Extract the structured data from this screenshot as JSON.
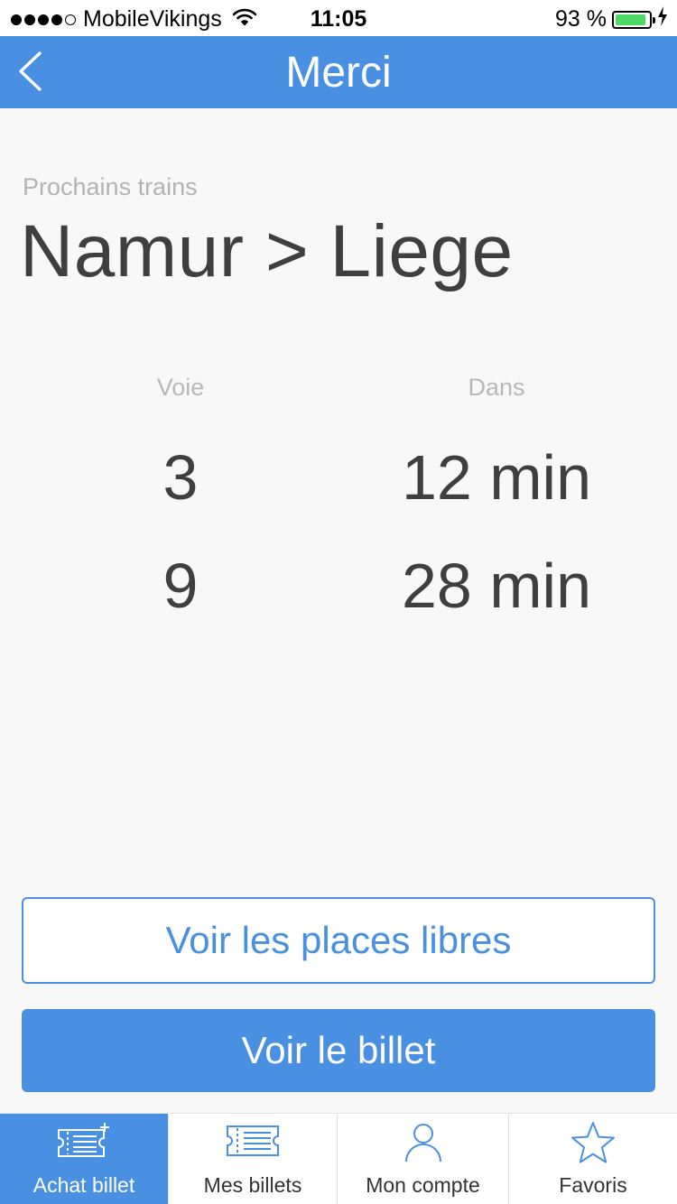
{
  "status_bar": {
    "carrier": "MobileVikings",
    "time": "11:05",
    "battery": "93 %",
    "battery_level": 0.93
  },
  "nav": {
    "title": "Merci",
    "back_icon": "chevron-left-icon"
  },
  "content": {
    "subtitle": "Prochains trains",
    "route": "Namur > Liege",
    "columns": {
      "platform": "Voie",
      "in": "Dans"
    },
    "rows": [
      {
        "platform": "3",
        "in": "12 min"
      },
      {
        "platform": "9",
        "in": "28 min"
      }
    ]
  },
  "buttons": {
    "free_seats": "Voir les places libres",
    "view_ticket": "Voir le billet"
  },
  "tabs": [
    {
      "label": "Achat billet",
      "icon": "ticket-add-icon",
      "active": true
    },
    {
      "label": "Mes billets",
      "icon": "ticket-icon",
      "active": false
    },
    {
      "label": "Mon compte",
      "icon": "user-icon",
      "active": false
    },
    {
      "label": "Favoris",
      "icon": "star-icon",
      "active": false
    }
  ],
  "colors": {
    "accent": "#4a90e2",
    "text_dark": "#3f3f3f",
    "text_muted": "#b3b3b3",
    "battery": "#4cd964"
  }
}
